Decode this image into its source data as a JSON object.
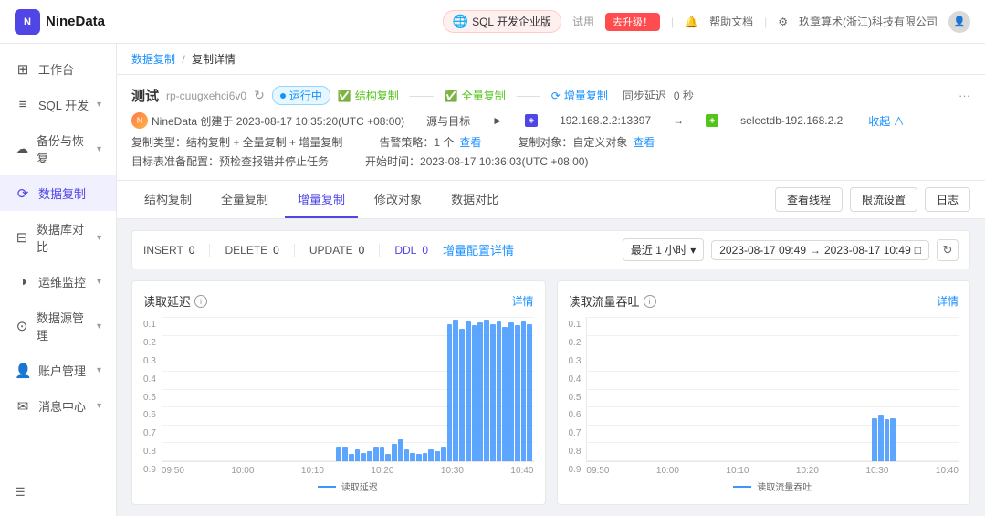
{
  "topNav": {
    "logo": "NineData",
    "logoInitial": "N",
    "sqlBadge": "SQL 开发企业版",
    "trialText": "试用",
    "upgradeBtn": "去升级！",
    "helpText": "帮助文档",
    "companyName": "玖章算术(浙江)科技有限公司"
  },
  "sidebar": {
    "items": [
      {
        "id": "workbench",
        "label": "工作台",
        "icon": "⊞",
        "hasChevron": false
      },
      {
        "id": "sql-dev",
        "label": "SQL 开发",
        "icon": "≡",
        "hasChevron": true
      },
      {
        "id": "backup",
        "label": "备份与恢复",
        "icon": "☁",
        "hasChevron": true
      },
      {
        "id": "data-replication",
        "label": "数据复制",
        "icon": "⟳",
        "hasChevron": false,
        "active": true
      },
      {
        "id": "data-compare",
        "label": "数据库对比",
        "icon": "⊟",
        "hasChevron": true
      },
      {
        "id": "ops-monitor",
        "label": "运维监控",
        "icon": "◑",
        "hasChevron": true
      },
      {
        "id": "datasource",
        "label": "数据源管理",
        "icon": "⊙",
        "hasChevron": true
      },
      {
        "id": "account",
        "label": "账户管理",
        "icon": "👤",
        "hasChevron": true
      },
      {
        "id": "messages",
        "label": "消息中心",
        "icon": "✉",
        "hasChevron": true
      }
    ],
    "collapseIcon": "☰"
  },
  "breadcrumb": {
    "parent": "数据复制",
    "current": "复制详情",
    "separator": "/"
  },
  "taskDetail": {
    "name": "测试",
    "taskId": "rp-cuugxehci6v0",
    "refreshIcon": "↻",
    "status": "运行中",
    "structureReplication": "结构复制",
    "fullReplication": "全量复制",
    "incrReplication": "增量复制",
    "syncDelay": "同步延迟",
    "syncDelayValue": "0 秒",
    "moreIcon": "···",
    "createdBy": "NineData 创建于 2023-08-17 10:35:20(UTC +08:00)",
    "sourceLabel": "源与目标",
    "sourceIP": "192.168.2.2:13397",
    "targetDB": "selectdb-192.168.2.2",
    "collapseText": "收起 ∧",
    "replicationType": "复制类型：结构复制 + 全量复制 + 增量复制",
    "alertPolicy": "告警策略：1 个",
    "alertLink": "查看",
    "replicationTarget": "复制对象：自定义对象",
    "replicationTargetLink": "查看",
    "targetTableConfig": "目标表准备配置：预检查报错并停止任务",
    "startTime": "开始时间：2023-08-17 10:36:03(UTC +08:00)"
  },
  "tabs": {
    "items": [
      {
        "id": "structure",
        "label": "结构复制"
      },
      {
        "id": "full",
        "label": "全量复制"
      },
      {
        "id": "incremental",
        "label": "增量复制",
        "active": true
      },
      {
        "id": "modify-objects",
        "label": "修改对象"
      },
      {
        "id": "data-compare",
        "label": "数据对比"
      }
    ],
    "actions": [
      {
        "id": "view-progress",
        "label": "查看线程"
      },
      {
        "id": "limit-settings",
        "label": "限流设置"
      },
      {
        "id": "logs",
        "label": "日志"
      }
    ]
  },
  "incrStats": {
    "insert": {
      "label": "INSERT",
      "value": "0"
    },
    "delete": {
      "label": "DELETE",
      "value": "0"
    },
    "update": {
      "label": "UPDATE",
      "value": "0"
    },
    "ddl": {
      "label": "DDL",
      "value": "0"
    },
    "detailLink": "增量配置详情",
    "timeRange": {
      "preset": "最近 1 小时",
      "start": "2023-08-17 09:49",
      "end": "2023-08-17 10:49",
      "calendarIcon": "□",
      "refreshIcon": "↻"
    }
  },
  "charts": {
    "readDelay": {
      "title": "读取延迟",
      "detailLink": "详情",
      "yLabels": [
        "0.9",
        "0.8",
        "0.7",
        "0.6",
        "0.5",
        "0.4",
        "0.3",
        "0.2",
        "0.1"
      ],
      "xLabels": [
        "09:50",
        "10:00",
        "10:10",
        "10:20",
        "10:30",
        "10:40"
      ],
      "legendLabel": "读取延迟",
      "bars": [
        0,
        0,
        0,
        0,
        0,
        0,
        0,
        0,
        0,
        0,
        0,
        0,
        0,
        0,
        0,
        0,
        0,
        0,
        0,
        0,
        0,
        0,
        0,
        0,
        0,
        0,
        0,
        0,
        0.1,
        0.1,
        0.05,
        0.08,
        0.06,
        0.07,
        0.1,
        0.1,
        0.05,
        0.12,
        0.15,
        0.08,
        0.06,
        0.05,
        0.06,
        0.08,
        0.07,
        0.1,
        0.95,
        0.98,
        0.92,
        0.97,
        0.94,
        0.96,
        0.98,
        0.95,
        0.97,
        0.93,
        0.96,
        0.94,
        0.97,
        0.95
      ]
    },
    "readThroughput": {
      "title": "读取流量吞吐",
      "detailLink": "详情",
      "yLabels": [
        "0.9",
        "0.8",
        "0.7",
        "0.6",
        "0.5",
        "0.4",
        "0.3",
        "0.2",
        "0.1"
      ],
      "xLabels": [
        "09:50",
        "10:00",
        "10:10",
        "10:20",
        "10:30",
        "10:40"
      ],
      "legendLabel": "读取流量吞吐",
      "bars": [
        0,
        0,
        0,
        0,
        0,
        0,
        0,
        0,
        0,
        0,
        0,
        0,
        0,
        0,
        0,
        0,
        0,
        0,
        0,
        0,
        0,
        0,
        0,
        0,
        0,
        0,
        0,
        0,
        0,
        0,
        0,
        0,
        0,
        0,
        0,
        0,
        0,
        0,
        0,
        0,
        0,
        0,
        0,
        0,
        0,
        0,
        0.3,
        0.32,
        0.29,
        0.3,
        0,
        0,
        0,
        0,
        0,
        0,
        0,
        0,
        0,
        0
      ]
    }
  }
}
